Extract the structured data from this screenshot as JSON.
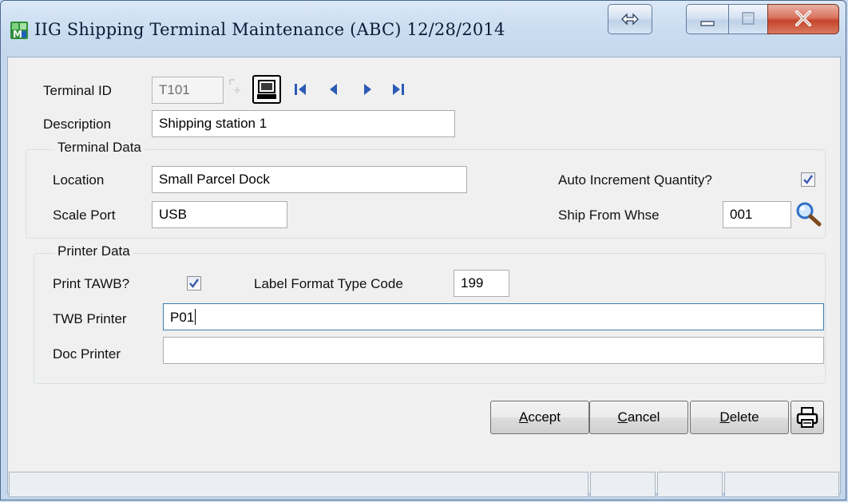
{
  "window": {
    "title": "IIG Shipping Terminal Maintenance (ABC) 12/28/2014"
  },
  "form": {
    "terminal_id_label": "Terminal ID",
    "terminal_id_value": "T101",
    "description_label": "Description",
    "description_value": "Shipping station 1"
  },
  "terminal_data": {
    "title": "Terminal Data",
    "location_label": "Location",
    "location_value": "Small Parcel Dock",
    "scale_port_label": "Scale Port",
    "scale_port_value": "USB",
    "auto_increment_label": "Auto Increment Quantity?",
    "auto_increment_checked": true,
    "ship_from_whse_label": "Ship From Whse",
    "ship_from_whse_value": "001"
  },
  "printer_data": {
    "title": "Printer Data",
    "print_tawb_label": "Print TAWB?",
    "print_tawb_checked": true,
    "label_format_label": "Label Format Type Code",
    "label_format_value": "199",
    "twb_printer_label": "TWB Printer",
    "twb_printer_value": "P01",
    "doc_printer_label": "Doc Printer",
    "doc_printer_value": ""
  },
  "buttons": {
    "accept": {
      "mnemonic": "A",
      "rest": "ccept"
    },
    "cancel": {
      "mnemonic": "C",
      "rest": "ancel"
    },
    "delete": {
      "mnemonic": "D",
      "rest": "elete"
    }
  },
  "icons": {
    "app": "app-icon",
    "restore": "resize-icon",
    "minimize": "minimize-icon",
    "maximize": "maximize-icon",
    "close": "close-icon",
    "lookup": "lookup-icon",
    "terminal": "terminal-icon",
    "first": "first-record-icon",
    "prev": "previous-record-icon",
    "next": "next-record-icon",
    "last": "last-record-icon",
    "search": "search-icon",
    "print": "printer-icon"
  },
  "colors": {
    "accent_blue": "#2b5bb5",
    "window_frame": "#c4d7ec",
    "close_red": "#c4452b"
  }
}
